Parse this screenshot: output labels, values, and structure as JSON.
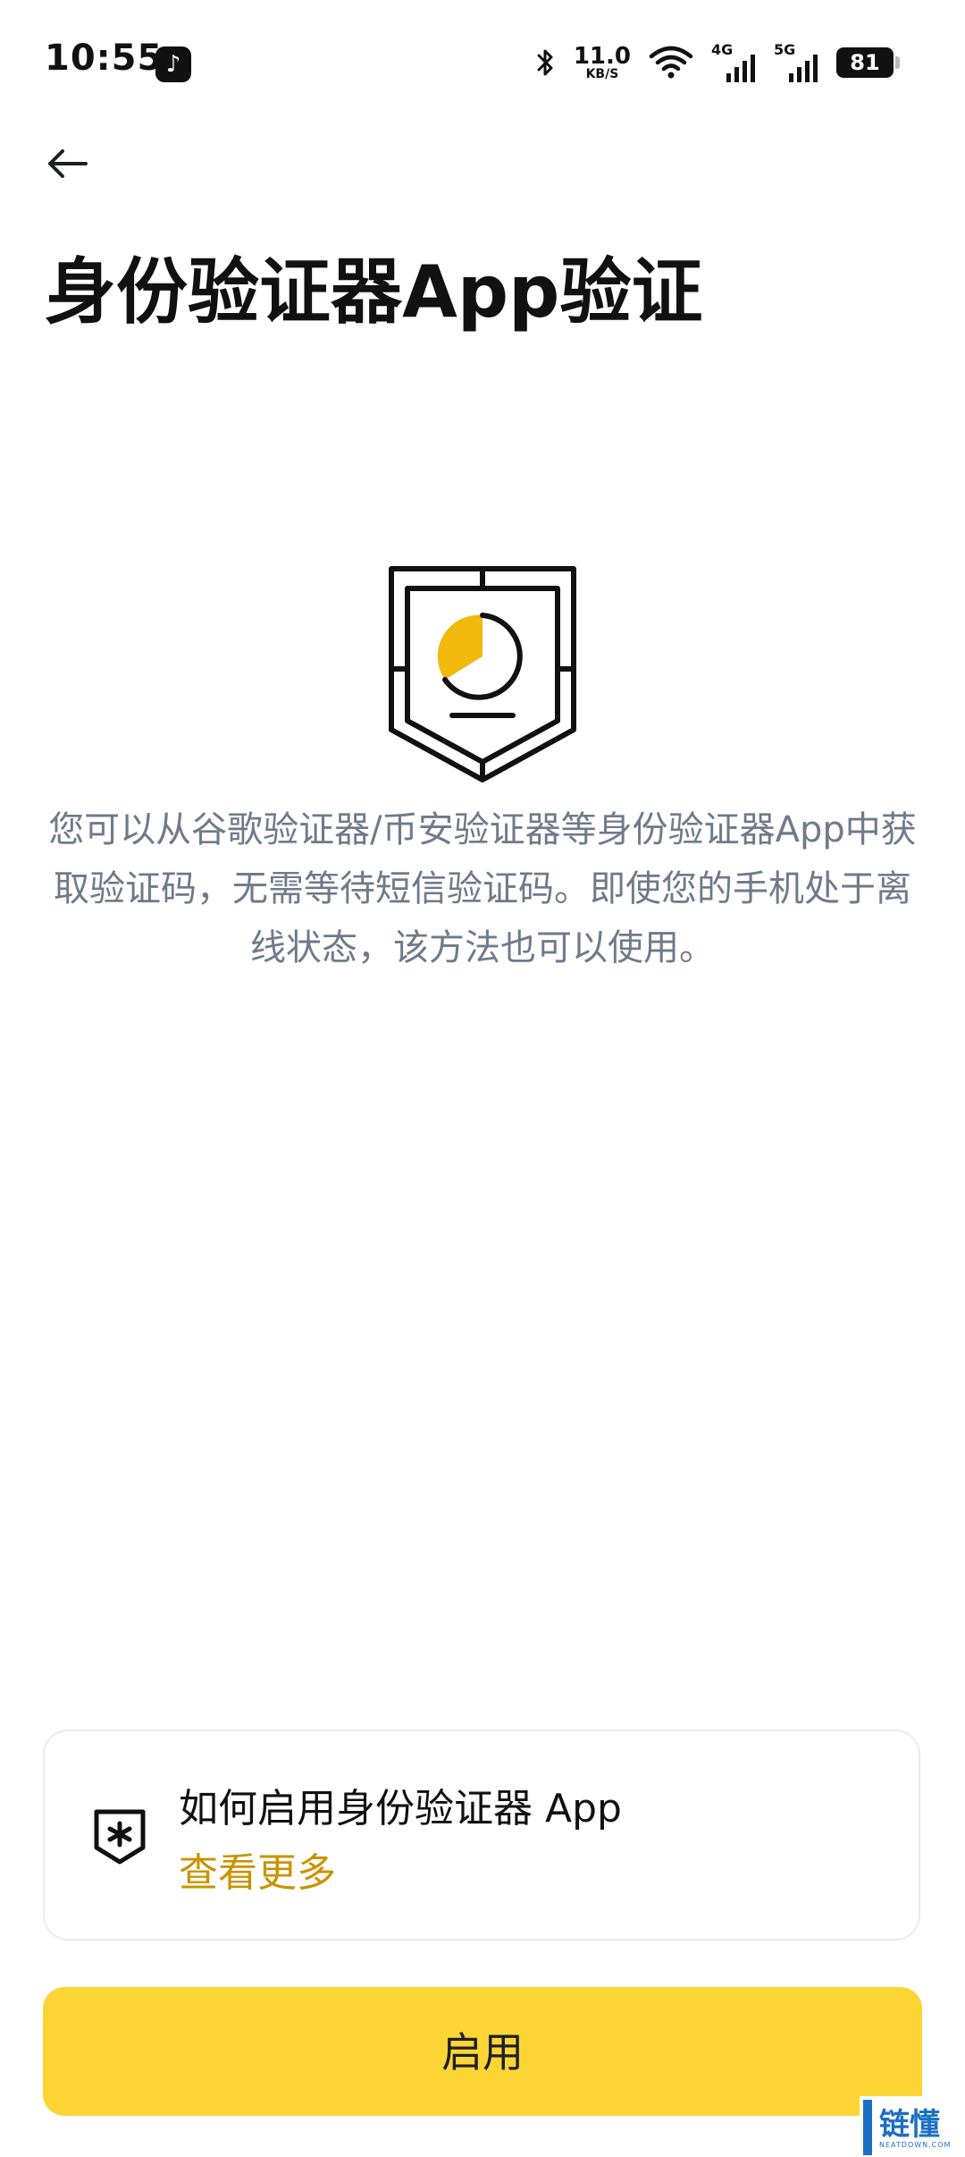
{
  "status_bar": {
    "time": "10:55",
    "app_badge": "♪",
    "net_speed_value": "11.0",
    "net_speed_unit": "KB/S",
    "signal_1_label": "4G",
    "signal_2_label": "5G",
    "battery": "81",
    "icons": [
      "tiktok-icon",
      "bluetooth-icon",
      "wifi-icon",
      "signal-icon",
      "battery-icon"
    ]
  },
  "header": {
    "back_icon": "arrow-left-icon",
    "title": "身份验证器App验证"
  },
  "illustration": {
    "icon": "shield-authenticator-icon",
    "accent_color": "#F0B90B"
  },
  "description": "您可以从谷歌验证器/币安验证器等身份验证器App中获取验证码，无需等待短信验证码。即使您的手机处于离线状态，该方法也可以使用。",
  "info_card": {
    "icon": "shield-asterisk-icon",
    "title": "如何启用身份验证器 App",
    "link_label": "查看更多",
    "link_color": "#C99400"
  },
  "primary_button": {
    "label": "启用",
    "color": "#FCD535"
  },
  "watermark": {
    "text": "链懂",
    "sub": "NEATDOWN.COM"
  }
}
